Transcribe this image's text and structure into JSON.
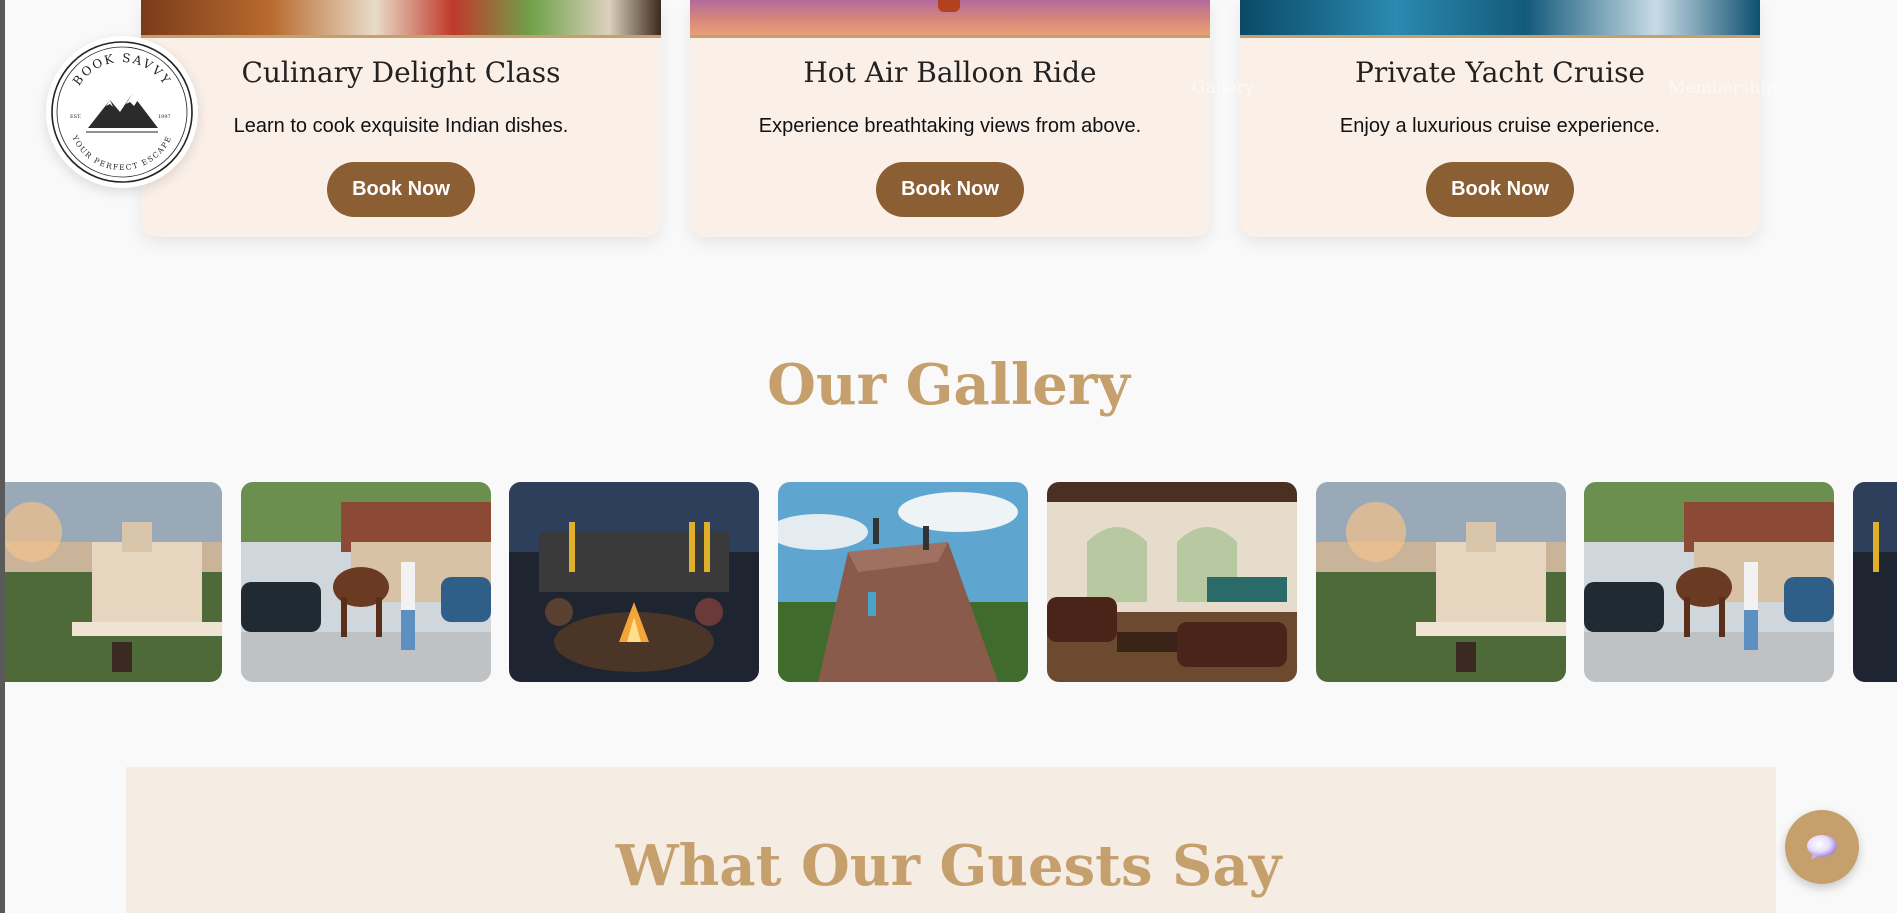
{
  "brand": {
    "logo_top": "BOOK SAVVY",
    "logo_bottom": "YOUR PERFECT ESCAPE",
    "logo_est": "EST.",
    "logo_year": "1997"
  },
  "nav": {
    "link_1": "Gallery",
    "link_2": "Membership"
  },
  "experiences": [
    {
      "title": "Culinary Delight Class",
      "description": "Learn to cook exquisite Indian dishes.",
      "button": "Book Now",
      "image": "culinary-image"
    },
    {
      "title": "Hot Air Balloon Ride",
      "description": "Experience breathtaking views from above.",
      "button": "Book Now",
      "image": "balloon-image"
    },
    {
      "title": "Private Yacht Cruise",
      "description": "Enjoy a luxurious cruise experience.",
      "button": "Book Now",
      "image": "yacht-image"
    }
  ],
  "gallery": {
    "title": "Our Gallery",
    "images": [
      "palace-terrace-sunset",
      "horse-riding",
      "bonfire-night",
      "rock-climbing",
      "lounge-billiards",
      "palace-terrace-sunset",
      "horse-riding",
      "bonfire-night"
    ]
  },
  "testimonials": {
    "title": "What Our Guests Say"
  },
  "chat": {
    "icon": "chat-bubble-icon"
  },
  "colors": {
    "accent": "#c59f6c",
    "button": "#8b5e34",
    "card_bg": "#fbf0e8",
    "page_bg": "#f9f9f9"
  }
}
